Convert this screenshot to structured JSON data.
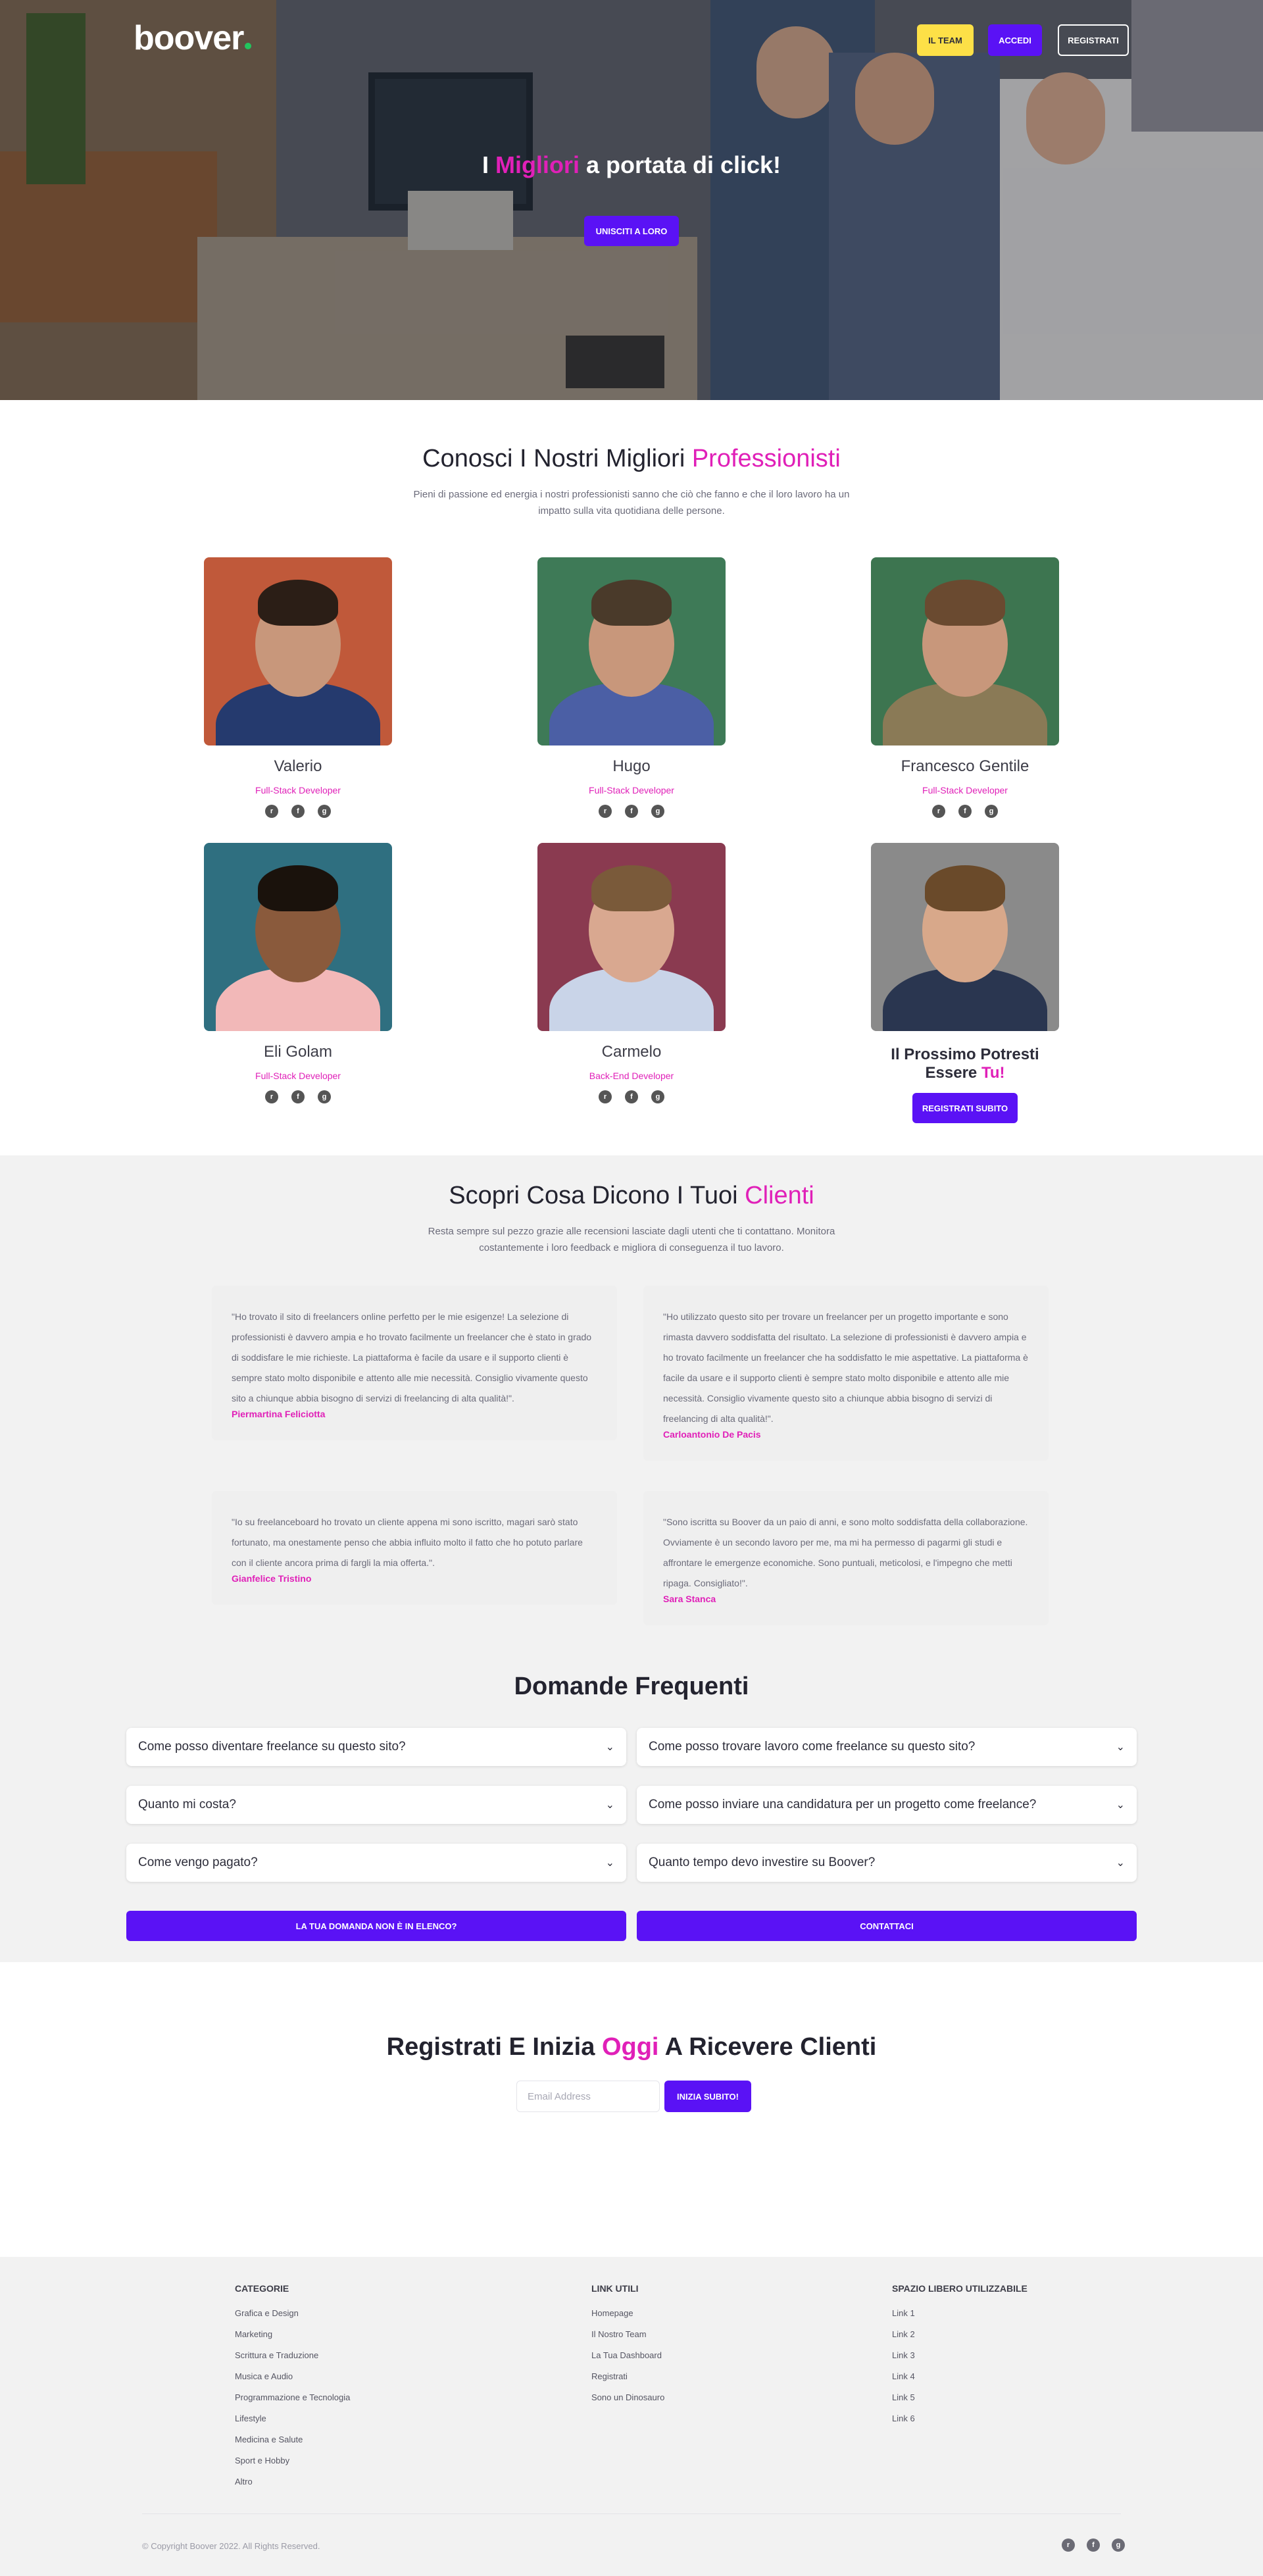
{
  "brand": {
    "logo": "boover"
  },
  "nav": {
    "team": "IL TEAM",
    "login": "ACCEDI",
    "signup": "REGISTRATI"
  },
  "hero": {
    "title_pre": "I ",
    "title_accent": "Migliori",
    "title_post": " a portata di click!",
    "cta": "UNISCITI A LORO"
  },
  "team": {
    "title_pre": "Conosci I Nostri Migliori ",
    "title_accent": "Professionisti",
    "subtitle": "Pieni di passione ed energia i nostri professionisti sanno che ciò che fanno e che il loro lavoro ha un impatto sulla vita quotidiana delle persone.",
    "members": [
      {
        "name": "Valerio",
        "role": "Full-Stack Developer",
        "bg": "#c0593a"
      },
      {
        "name": "Hugo",
        "role": "Full-Stack Developer",
        "bg": "#3e7a57"
      },
      {
        "name": "Francesco Gentile",
        "role": "Full-Stack Developer",
        "bg": "#3d7550"
      },
      {
        "name": "Eli Golam",
        "role": "Full-Stack Developer",
        "bg": "#2f6f80"
      },
      {
        "name": "Carmelo",
        "role": "Back-End Developer",
        "bg": "#8a3a50"
      }
    ],
    "next": {
      "title_pre": "Il Prossimo Potresti Essere ",
      "title_accent": "Tu!",
      "button": "REGISTRATI SUBITO"
    },
    "social_icons": [
      "reddit-icon",
      "facebook-icon",
      "github-icon"
    ]
  },
  "reviews": {
    "title_pre": "Scopri Cosa Dicono I Tuoi ",
    "title_accent": "Clienti",
    "subtitle": "Resta sempre sul pezzo grazie alle recensioni lasciate dagli utenti che ti contattano. Monitora costantemente i loro feedback e migliora di conseguenza il tuo lavoro.",
    "items": [
      {
        "text": "\"Ho trovato il sito di freelancers online perfetto per le mie esigenze! La selezione di professionisti è davvero ampia e ho trovato facilmente un freelancer che è stato in grado di soddisfare le mie richieste. La piattaforma è facile da usare e il supporto clienti è sempre stato molto disponibile e attento alle mie necessità. Consiglio vivamente questo sito a chiunque abbia bisogno di servizi di freelancing di alta qualità!\".",
        "author": "Piermartina Feliciotta"
      },
      {
        "text": "\"Ho utilizzato questo sito per trovare un freelancer per un progetto importante e sono rimasta davvero soddisfatta del risultato. La selezione di professionisti è davvero ampia e ho trovato facilmente un freelancer che ha soddisfatto le mie aspettative. La piattaforma è facile da usare e il supporto clienti è sempre stato molto disponibile e attento alle mie necessità. Consiglio vivamente questo sito a chiunque abbia bisogno di servizi di freelancing di alta qualità!\".",
        "author": "Carloantonio De Pacis"
      },
      {
        "text": "\"Io su freelanceboard ho trovato un cliente appena mi sono iscritto, magari sarò stato fortunato, ma onestamente penso che abbia influito molto il fatto che ho potuto parlare con il cliente ancora prima di fargli la mia offerta.\".",
        "author": "Gianfelice Tristino"
      },
      {
        "text": "\"Sono iscritta su Boover da un paio di anni, e sono molto soddisfatta della collaborazione. Ovviamente è un secondo lavoro per me, ma mi ha permesso di pagarmi gli studi e affrontare le emergenze economiche. Sono puntuali, meticolosi, e l'impegno che metti ripaga. Consigliato!\".",
        "author": "Sara Stanca"
      }
    ]
  },
  "faq": {
    "title": "Domande Frequenti",
    "questions": [
      "Come posso diventare freelance su questo sito?",
      "Come posso trovare lavoro come freelance su questo sito?",
      "Quanto mi costa?",
      "Come posso inviare una candidatura per un progetto come freelance?",
      "Come vengo pagato?",
      "Quanto tempo devo investire su Boover?"
    ],
    "not_listed": "LA TUA DOMANDA NON È IN ELENCO?",
    "contact": "CONTATTACI"
  },
  "signup": {
    "title_pre": "Registrati E Inizia ",
    "title_accent": "Oggi",
    "title_post": " A Ricevere Clienti",
    "email_placeholder": "Email Address",
    "button": "INIZIA SUBITO!"
  },
  "footer": {
    "categories": {
      "heading": "CATEGORIE",
      "links": [
        "Grafica e Design",
        "Marketing",
        "Scrittura e Traduzione",
        "Musica e Audio",
        "Programmazione e Tecnologia",
        "Lifestyle",
        "Medicina e Salute",
        "Sport e Hobby",
        "Altro"
      ]
    },
    "useful": {
      "heading": "LINK UTILI",
      "links": [
        "Homepage",
        "Il Nostro Team",
        "La Tua Dashboard",
        "Registrati",
        "Sono un Dinosauro"
      ]
    },
    "free": {
      "heading": "SPAZIO LIBERO UTILIZZABILE",
      "links": [
        "Link 1",
        "Link 2",
        "Link 3",
        "Link 4",
        "Link 5",
        "Link 6"
      ]
    },
    "copyright": "© Copyright Boover 2022. All Rights Reserved."
  },
  "colors": {
    "accent": "#e020b8",
    "primary": "#5a12f5",
    "yellow": "#fde047"
  }
}
